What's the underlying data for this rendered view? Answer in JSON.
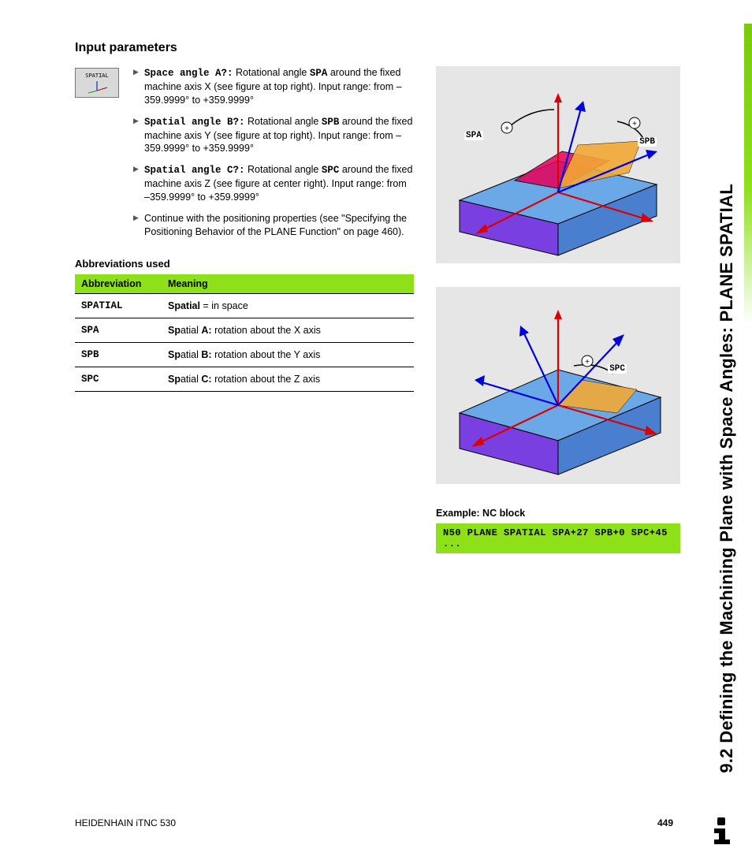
{
  "side_title": "9.2 Defining the Machining Plane with Space Angles: PLANE SPATIAL",
  "heading": "Input parameters",
  "icon_label": "SPATIAL",
  "params": [
    {
      "label": "Space angle A?:",
      "body_a": " Rotational angle ",
      "code": "SPA",
      "body_b": " around the fixed machine axis X (see figure at top right). Input range: from –359.9999° to +359.9999°"
    },
    {
      "label": "Spatial angle B?:",
      "body_a": " Rotational angle ",
      "code": "SPB",
      "body_b": " around the fixed machine axis Y (see figure at top right). Input range: from –359.9999° to +359.9999°"
    },
    {
      "label": "Spatial angle C?:",
      "body_a": " Rotational angle ",
      "code": "SPC",
      "body_b": " around the fixed machine axis Z (see figure at center right). Input range: from –359.9999° to +359.9999°"
    },
    {
      "label": "",
      "body_a": "Continue with the positioning properties (see \"Specifying the Positioning Behavior of the PLANE Function\" on page 460).",
      "code": "",
      "body_b": ""
    }
  ],
  "abbr_heading": "Abbreviations used",
  "abbr_columns": {
    "c1": "Abbreviation",
    "c2": "Meaning"
  },
  "abbr_rows": [
    {
      "ab": "SPATIAL",
      "bold": "Spatial",
      "rest": " = in space"
    },
    {
      "ab": "SPA",
      "bold": "Sp",
      "mid": "atial ",
      "bold2": "A:",
      "rest": " rotation about the X axis"
    },
    {
      "ab": "SPB",
      "bold": "Sp",
      "mid": "atial ",
      "bold2": "B:",
      "rest": " rotation about the Y axis"
    },
    {
      "ab": "SPC",
      "bold": "Sp",
      "mid": "atial ",
      "bold2": "C:",
      "rest": " rotation about the Z axis"
    }
  ],
  "fig1": {
    "spa": "SPA",
    "spb": "SPB",
    "plus": "+"
  },
  "fig2": {
    "spc": "SPC",
    "plus": "+"
  },
  "example_label": "Example: NC block",
  "example_code": "N50 PLANE SPATIAL SPA+27 SPB+0 SPC+45 ...",
  "footer_left": "HEIDENHAIN iTNC 530",
  "footer_page": "449"
}
